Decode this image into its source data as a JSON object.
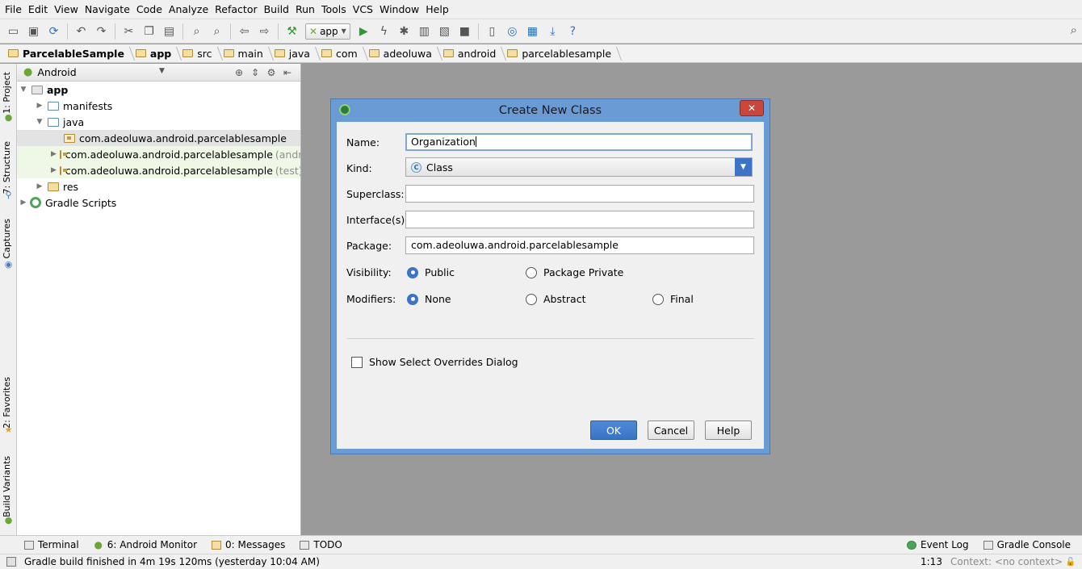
{
  "menu": [
    "File",
    "Edit",
    "View",
    "Navigate",
    "Code",
    "Analyze",
    "Refactor",
    "Build",
    "Run",
    "Tools",
    "VCS",
    "Window",
    "Help"
  ],
  "toolbar": {
    "run_config": "app"
  },
  "breadcrumb": [
    "ParcelableSample",
    "app",
    "src",
    "main",
    "java",
    "com",
    "adeoluwa",
    "android",
    "parcelablesample"
  ],
  "left_strip": {
    "project": "1: Project",
    "structure": "7: Structure",
    "captures": "Captures",
    "favorites": "2: Favorites",
    "build_variants": "Build Variants"
  },
  "project_panel": {
    "view": "Android",
    "tree": {
      "app": "app",
      "manifests": "manifests",
      "java": "java",
      "pkg_main": "com.adeoluwa.android.parcelablesample",
      "pkg_android_test": "com.adeoluwa.android.parcelablesample",
      "pkg_android_test_suffix": "(androidT",
      "pkg_test": "com.adeoluwa.android.parcelablesample",
      "pkg_test_suffix": "(test)",
      "res": "res",
      "gradle": "Gradle Scripts"
    }
  },
  "dialog": {
    "title": "Create New Class",
    "close": "✕",
    "name_label": "Name:",
    "name_value": "Organization",
    "kind_label": "Kind:",
    "kind_value": "Class",
    "kind_icon_letter": "C",
    "superclass_label": "Superclass:",
    "superclass_value": "",
    "interfaces_label": "Interface(s):",
    "interfaces_value": "",
    "package_label": "Package:",
    "package_value": "com.adeoluwa.android.parcelablesample",
    "visibility_label": "Visibility:",
    "visibility_public": "Public",
    "visibility_package_private": "Package Private",
    "modifiers_label": "Modifiers:",
    "modifier_none": "None",
    "modifier_abstract": "Abstract",
    "modifier_final": "Final",
    "show_overrides": "Show Select Overrides Dialog",
    "ok": "OK",
    "cancel": "Cancel",
    "help": "Help"
  },
  "bottom_tabs": {
    "terminal": "Terminal",
    "android_monitor": "6: Android Monitor",
    "messages": "0: Messages",
    "todo": "TODO",
    "event_log": "Event Log",
    "gradle_console": "Gradle Console"
  },
  "status": {
    "message": "Gradle build finished in 4m 19s 120ms (yesterday 10:04 AM)",
    "position": "1:13",
    "context": "Context: <no context>"
  },
  "colors": {
    "accent": "#3c73c7",
    "dialog_frame": "#6a9bd4",
    "close_button": "#c9463d",
    "android_green": "#6ca736"
  }
}
